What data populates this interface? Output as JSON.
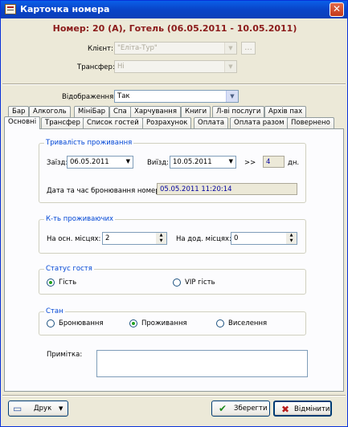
{
  "window": {
    "title": "Карточка номера",
    "close": "✕"
  },
  "heading": "Номер: 20 (A), Готель (06.05.2011 - 10.05.2011)",
  "client": {
    "label": "Клієнт:",
    "value": "\"Еліта-Тур\"",
    "button": "..."
  },
  "transfer": {
    "label": "Трансфер:",
    "value": "Ні"
  },
  "display": {
    "label": "Відображення:",
    "value": "Так"
  },
  "tabs_row1": [
    "Бар",
    "Алкоголь",
    "МініБар",
    "Спа",
    "Харчування",
    "Книги",
    "Л-ві послуги",
    "Архів пах"
  ],
  "tabs_row2": [
    "Основні",
    "Трансфер",
    "Список гостей",
    "Розрахунок",
    "Оплата",
    "Оплата разом",
    "Повернено"
  ],
  "active_tab": "Основні",
  "stay": {
    "title": "Тривалість проживання",
    "checkin_label": "Заїзд:",
    "checkin": "06.05.2011",
    "checkout_label": "Виїзд:",
    "checkout": "10.05.2011",
    "arrow": ">>",
    "days": "4",
    "days_unit": "дн.",
    "booking_label": "Дата та час бронювання номера:",
    "booking": "05.05.2011 11:20:14"
  },
  "residents": {
    "title": "К-ть проживаючих",
    "main_label": "На осн. місцях:",
    "main": "2",
    "extra_label": "На дод. місцях:",
    "extra": "0"
  },
  "guest_status": {
    "title": "Статус гостя",
    "options": [
      "Гість",
      "VIP гість"
    ],
    "selected": "Гість"
  },
  "state": {
    "title": "Стан",
    "options": [
      "Бронювання",
      "Проживання",
      "Виселення"
    ],
    "selected": "Проживання"
  },
  "note_label": "Примітка:",
  "footer": {
    "print": "Друк",
    "save": "Зберегти",
    "cancel": "Відмінити"
  },
  "colors": {
    "heading": "#8b1a1a",
    "group_title": "#0046d5",
    "titlebar": "#0a4fd8"
  },
  "icons": {
    "print": "printer-icon",
    "save": "checkmark-icon",
    "cancel": "x-icon"
  }
}
